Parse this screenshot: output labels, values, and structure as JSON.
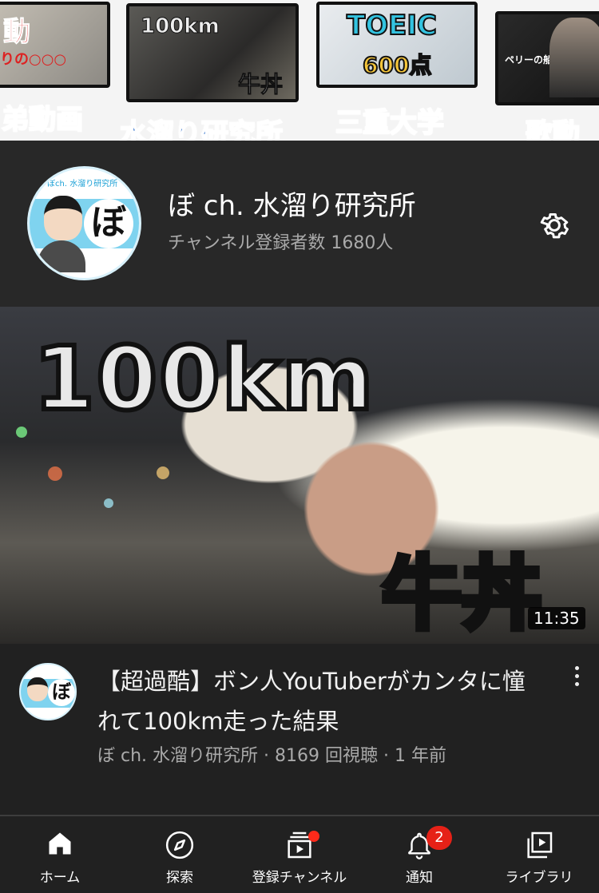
{
  "banner": {
    "tiles": [
      {
        "overlay": "動",
        "sub": "りの○○○",
        "caption": "弟動画"
      },
      {
        "overlay": "100km",
        "sub": "牛丼",
        "caption": "水溜り研究所"
      },
      {
        "overlay": "TOEIC",
        "sub": "600点",
        "caption": "三重大学"
      },
      {
        "overlay": "ペリーの船に",
        "caption": "歌動画"
      }
    ]
  },
  "channel": {
    "name": "ぼ ch. 水溜り研究所",
    "subscribers": "チャンネル登録者数 1680人",
    "avatar_glyph": "ぼ",
    "avatar_small_text": "ぼch. 水溜り研究所"
  },
  "video": {
    "thumb_text_top": "100km",
    "thumb_text_bottom": "牛丼",
    "duration": "11:35",
    "title": "【超過酷】ボン人YouTuberがカンタに憧れて100km走った結果",
    "meta": "ぼ ch. 水溜り研究所 · 8169 回視聴 · 1 年前",
    "avatar_glyph": "ぼ"
  },
  "nav": {
    "items": [
      {
        "label": "ホーム",
        "icon": "home-icon"
      },
      {
        "label": "探索",
        "icon": "compass-icon"
      },
      {
        "label": "登録チャンネル",
        "icon": "subscriptions-icon"
      },
      {
        "label": "通知",
        "icon": "bell-icon",
        "badge": "2"
      },
      {
        "label": "ライブラリ",
        "icon": "library-icon"
      }
    ]
  },
  "colors": {
    "background": "#212121",
    "header_bg": "#282828",
    "badge_red": "#e62117",
    "secondary_text": "#aaaaaa"
  }
}
